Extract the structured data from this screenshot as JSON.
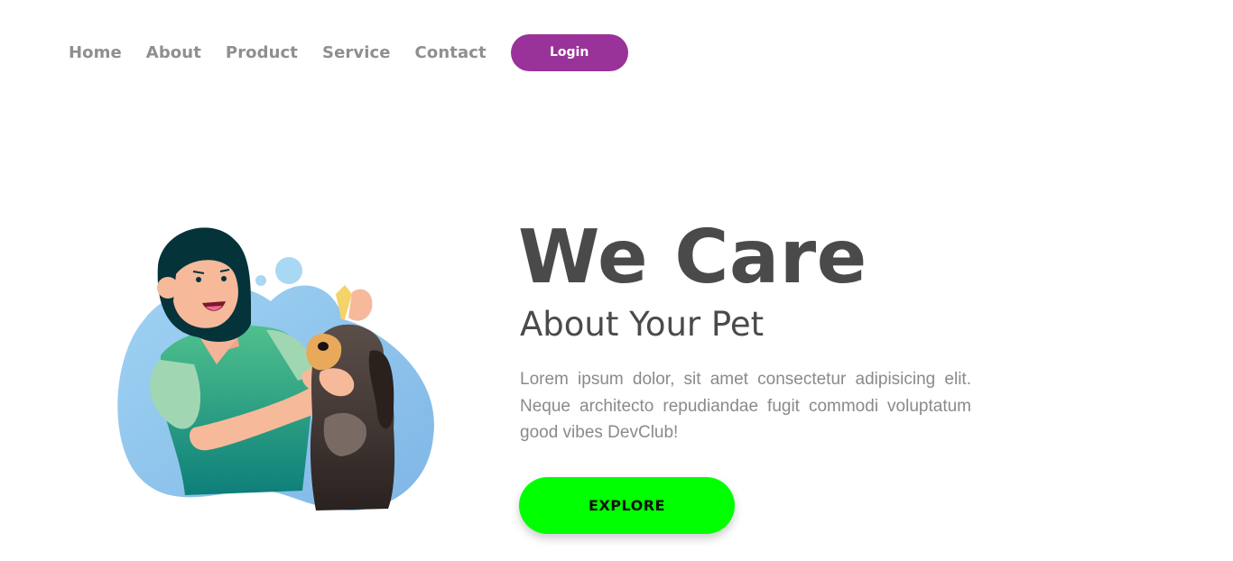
{
  "nav": {
    "links": [
      "Home",
      "About",
      "Product",
      "Service",
      "Contact"
    ],
    "login_label": "Login"
  },
  "hero": {
    "title": "We Care",
    "subtitle": "About Your Pet",
    "description": "Lorem ipsum dolor, sit amet consectetur adipisicing elit. Neque architecto repudiandae fugit commodi voluptatum good vibes DevClub!",
    "explore_label": "EXPLORE"
  },
  "colors": {
    "login_button": "#993399",
    "explore_button": "#00ff00",
    "heading_text": "#4a4a4a",
    "nav_text": "#8f8f8f",
    "illustration_blob": "#8ec9ee"
  },
  "illustration": {
    "icons": [
      "woman-vet-icon",
      "dog-icon",
      "dropper-icon",
      "bubble-icon"
    ]
  }
}
